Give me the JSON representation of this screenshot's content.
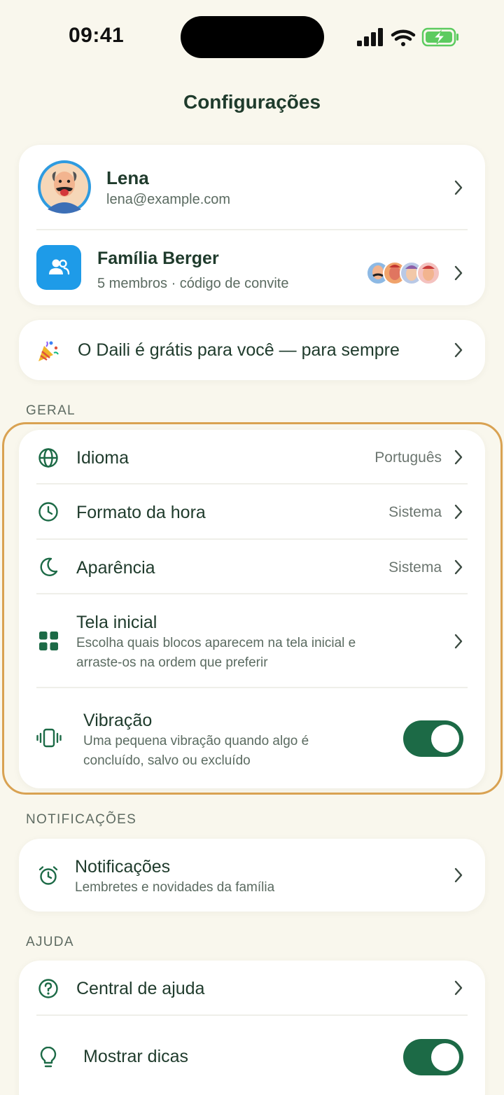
{
  "status_bar": {
    "time": "09:41"
  },
  "page_title": "Configurações",
  "profile": {
    "name": "Lena",
    "email": "lena@example.com"
  },
  "family": {
    "name": "Família Berger",
    "subtitle": "5 membros · código de convite"
  },
  "promo": {
    "label": "O Daili é grátis para você — para sempre"
  },
  "sections": {
    "general": "GERAL",
    "notifications": "NOTIFICAÇÕES",
    "help": "AJUDA"
  },
  "general": {
    "language": {
      "label": "Idioma",
      "value": "Português"
    },
    "time_format": {
      "label": "Formato da hora",
      "value": "Sistema"
    },
    "appearance": {
      "label": "Aparência",
      "value": "Sistema"
    },
    "home_screen": {
      "label": "Tela inicial",
      "subtitle_line1": "Escolha quais blocos aparecem na tela inicial e",
      "subtitle_line2": "arraste-os na ordem que preferir"
    },
    "vibration": {
      "label": "Vibração",
      "subtitle_line1": "Uma pequena vibração quando algo é",
      "subtitle_line2": "concluído, salvo ou excluído",
      "enabled": true
    }
  },
  "notifications": {
    "label": "Notificações",
    "subtitle": "Lembretes e novidades da família"
  },
  "help": {
    "help_center": {
      "label": "Central de ajuda"
    },
    "show_tips": {
      "label": "Mostrar dicas",
      "enabled": true
    }
  },
  "colors": {
    "background": "#f9f7ed",
    "accent_green": "#1c6a46",
    "family_icon_blue": "#1e9be8",
    "highlight_border": "#d9a252"
  }
}
